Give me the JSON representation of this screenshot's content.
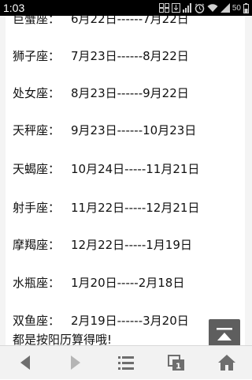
{
  "status_bar": {
    "time": "1:03",
    "battery": "50",
    "icons": [
      "gallery-icon",
      "download-icon",
      "alarm-icon",
      "wifi-icon",
      "signal-icon",
      "battery-icon"
    ]
  },
  "zodiac_rows": [
    {
      "name": "巨蟹座：",
      "range": "6月22日------7月22日"
    },
    {
      "name": "狮子座：",
      "range": "7月23日------8月22日"
    },
    {
      "name": "处女座：",
      "range": "8月23日------9月22日"
    },
    {
      "name": "天秤座：",
      "range": "9月23日------10月23日"
    },
    {
      "name": "天蝎座：",
      "range": "10月24日-----11月21日"
    },
    {
      "name": "射手座：",
      "range": "11月22日-----12月21日"
    },
    {
      "name": "摩羯座：",
      "range": "12月22日-----1月19日"
    },
    {
      "name": "水瓶座：",
      "range": "1月20日-----2月18日"
    },
    {
      "name": "双鱼座：",
      "range": "2月19日------3月20日"
    }
  ],
  "footer_note": "都是按阳历算得哦!",
  "bottom_bar": {
    "buttons": [
      "back-arrow-icon",
      "forward-arrow-icon",
      "menu-icon",
      "windows-icon",
      "home-icon"
    ],
    "windows_count": "1"
  },
  "colors": {
    "status_bar": "#000000",
    "text": "#111111",
    "back_to_top": "#5e5e5e",
    "bottom_bar": "#f2f2f2",
    "nav_icon": "#6e6e6e",
    "nav_icon_disabled": "#b5b5b5"
  }
}
